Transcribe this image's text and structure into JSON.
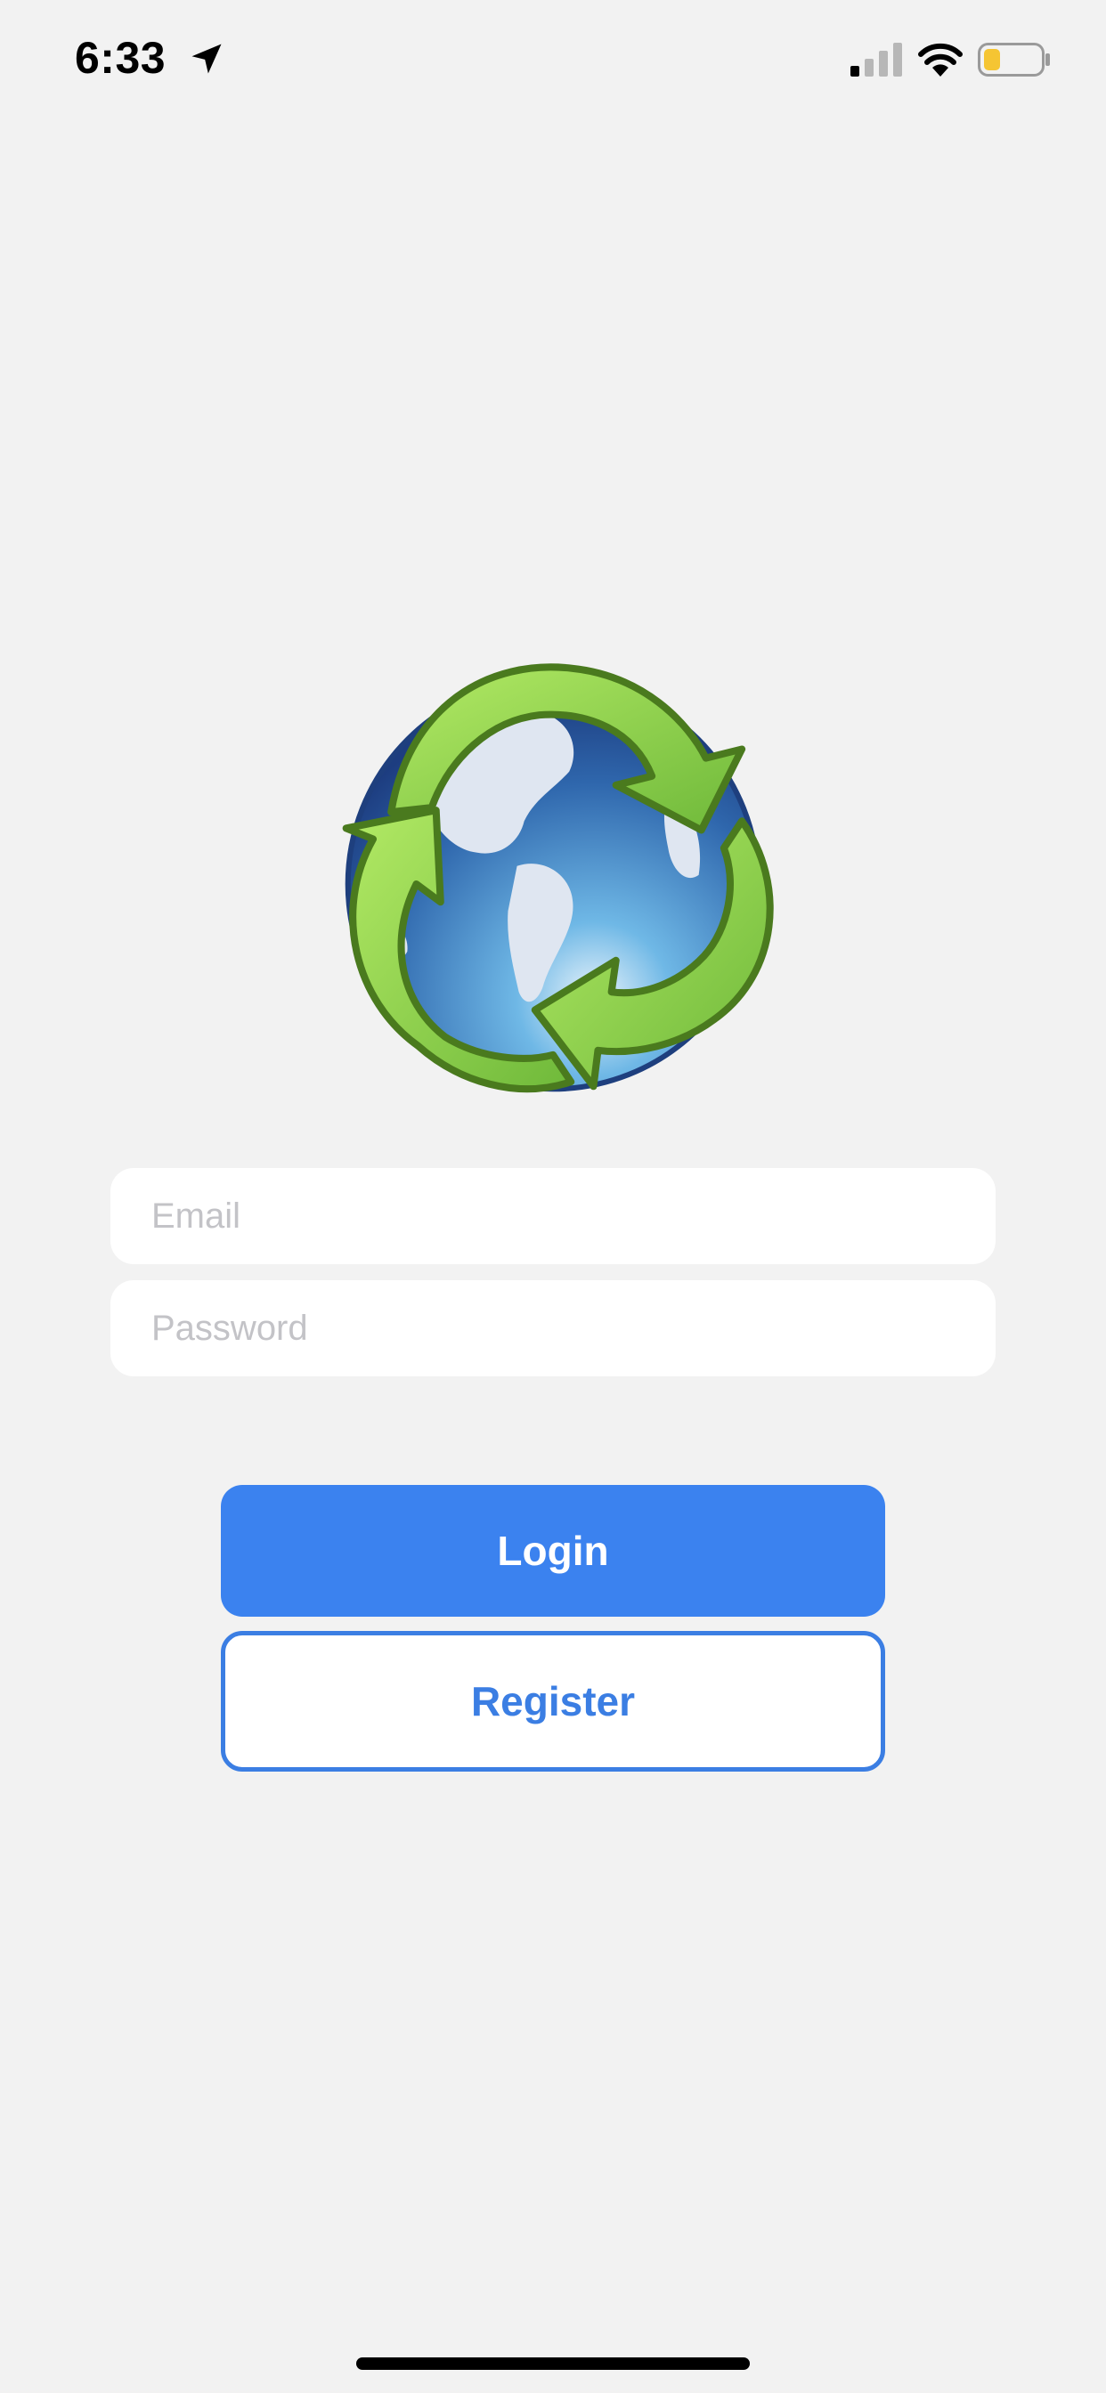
{
  "status_bar": {
    "time": "6:33",
    "icons": [
      "location-arrow-icon",
      "cellular-signal-icon",
      "wifi-icon",
      "battery-icon"
    ],
    "battery_color": "#f5c533"
  },
  "logo": {
    "icon": "recycle-globe-icon",
    "colors": {
      "arrow_green": "#8ccf4a",
      "arrow_outline": "#4a7a1e",
      "globe_blue": "#3a6fb3"
    }
  },
  "login_form": {
    "email_placeholder": "Email",
    "password_placeholder": "Password",
    "login_label": "Login",
    "register_label": "Register"
  },
  "colors": {
    "background": "#f2f2f2",
    "primary": "#3b82ef",
    "field_background": "#ffffff",
    "placeholder": "#c3c3c7"
  }
}
